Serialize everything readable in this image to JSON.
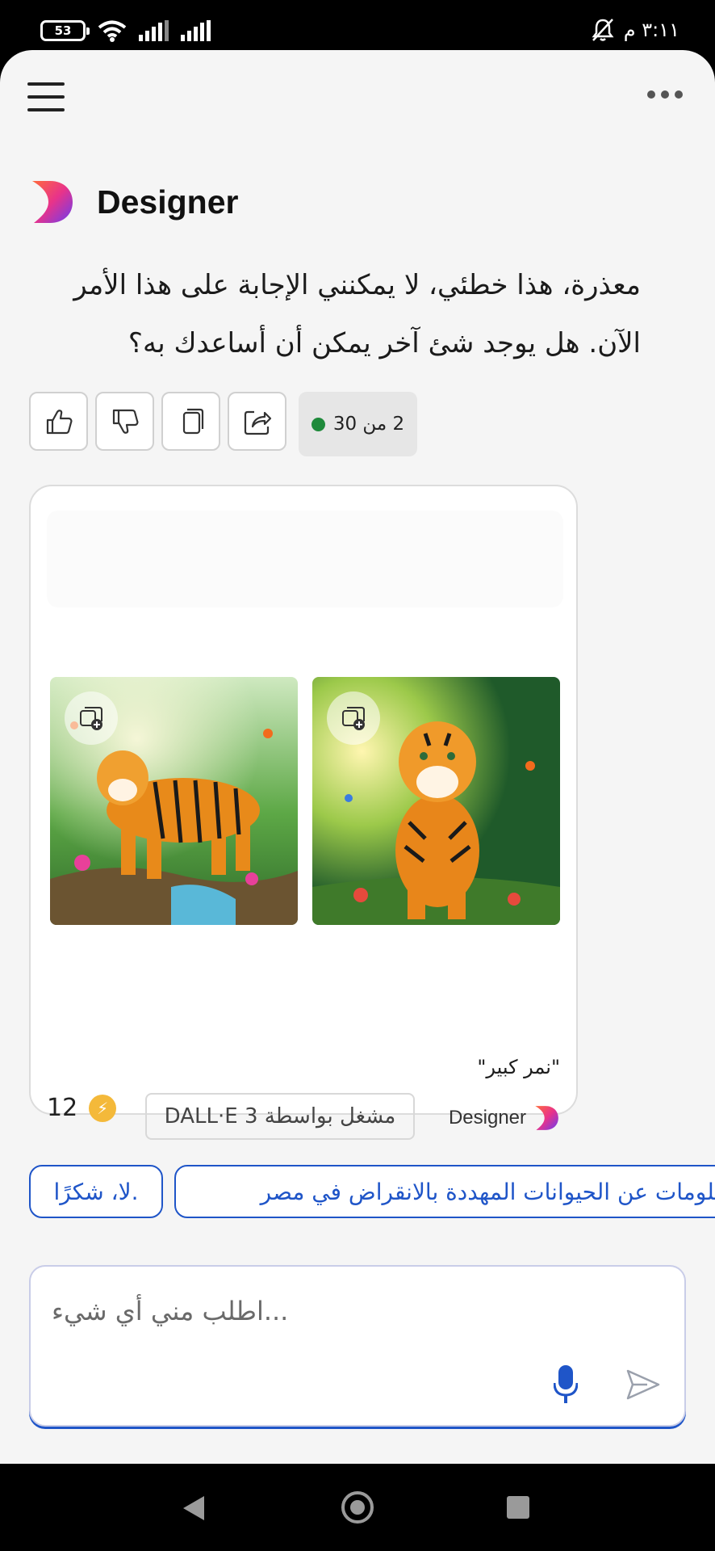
{
  "status_bar": {
    "battery": "53",
    "time": "٣:١١ م"
  },
  "header": {
    "assistant_name": "Designer"
  },
  "message": {
    "text": "معذرة، هذا خطئي، لا يمكنني الإجابة على هذا الأمر الآن. هل يوجد شئ آخر يمكن أن أساعدك به؟",
    "counter": "2 من 30"
  },
  "image_card": {
    "caption": "\"نمر كبير\"",
    "powered_by": "مشغل بواسطة DALL·E 3",
    "brand": "Designer",
    "coins": "12"
  },
  "suggestions": {
    "no_thanks": ".لا، شكرًا",
    "info": "معلومات عن الحيوانات المهددة بالانقراض في مصر"
  },
  "composer": {
    "placeholder": "...اطلب مني أي شيء"
  },
  "colors": {
    "accent": "#1f55c8",
    "status_green": "#1f8a3b",
    "coin": "#f4b93a"
  }
}
